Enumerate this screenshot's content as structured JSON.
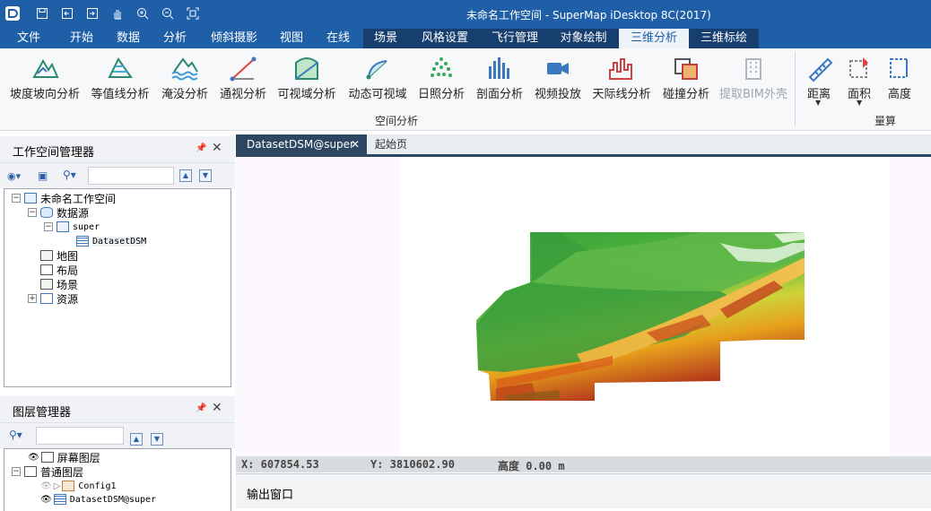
{
  "app": {
    "title": "未命名工作空间 - SuperMap iDesktop 8C(2017)"
  },
  "tabs": [
    "文件",
    "开始",
    "数据",
    "分析",
    "倾斜摄影",
    "视图",
    "在线",
    "场景",
    "风格设置",
    "飞行管理",
    "对象绘制",
    "三维分析",
    "三维标绘"
  ],
  "ribbon": {
    "buttons": [
      "坡度坡向分析",
      "等值线分析",
      "淹没分析",
      "通视分析",
      "可视域分析",
      "动态可视域",
      "日照分析",
      "剖面分析",
      "视频投放",
      "天际线分析",
      "碰撞分析",
      "提取BIM外壳"
    ],
    "measure": [
      "距离",
      "面积",
      "高度"
    ],
    "group1": "空间分析",
    "group2": "量算"
  },
  "workspace_panel": {
    "title": "工作空间管理器",
    "tree": {
      "root": "未命名工作空间",
      "datasources": "数据源",
      "super": "super",
      "dataset": "DatasetDSM",
      "maps": "地图",
      "layouts": "布局",
      "scenes": "场景",
      "resources": "资源"
    }
  },
  "layer_panel": {
    "title": "图层管理器",
    "screen_layer": "屏幕图层",
    "normal_layer": "普通图层",
    "config": "Config1",
    "dataset_layer": "DatasetDSM@super"
  },
  "doc_tabs": {
    "active": "DatasetDSM@super",
    "second": "起始页"
  },
  "status": {
    "x": "X: 607854.53",
    "y": "Y: 3810602.90",
    "height": "高度 0.00 m"
  },
  "output": {
    "title": "输出窗口"
  },
  "colors": {
    "title_bar": "#1e5fa8",
    "active_doc_tab": "#2d4763"
  }
}
